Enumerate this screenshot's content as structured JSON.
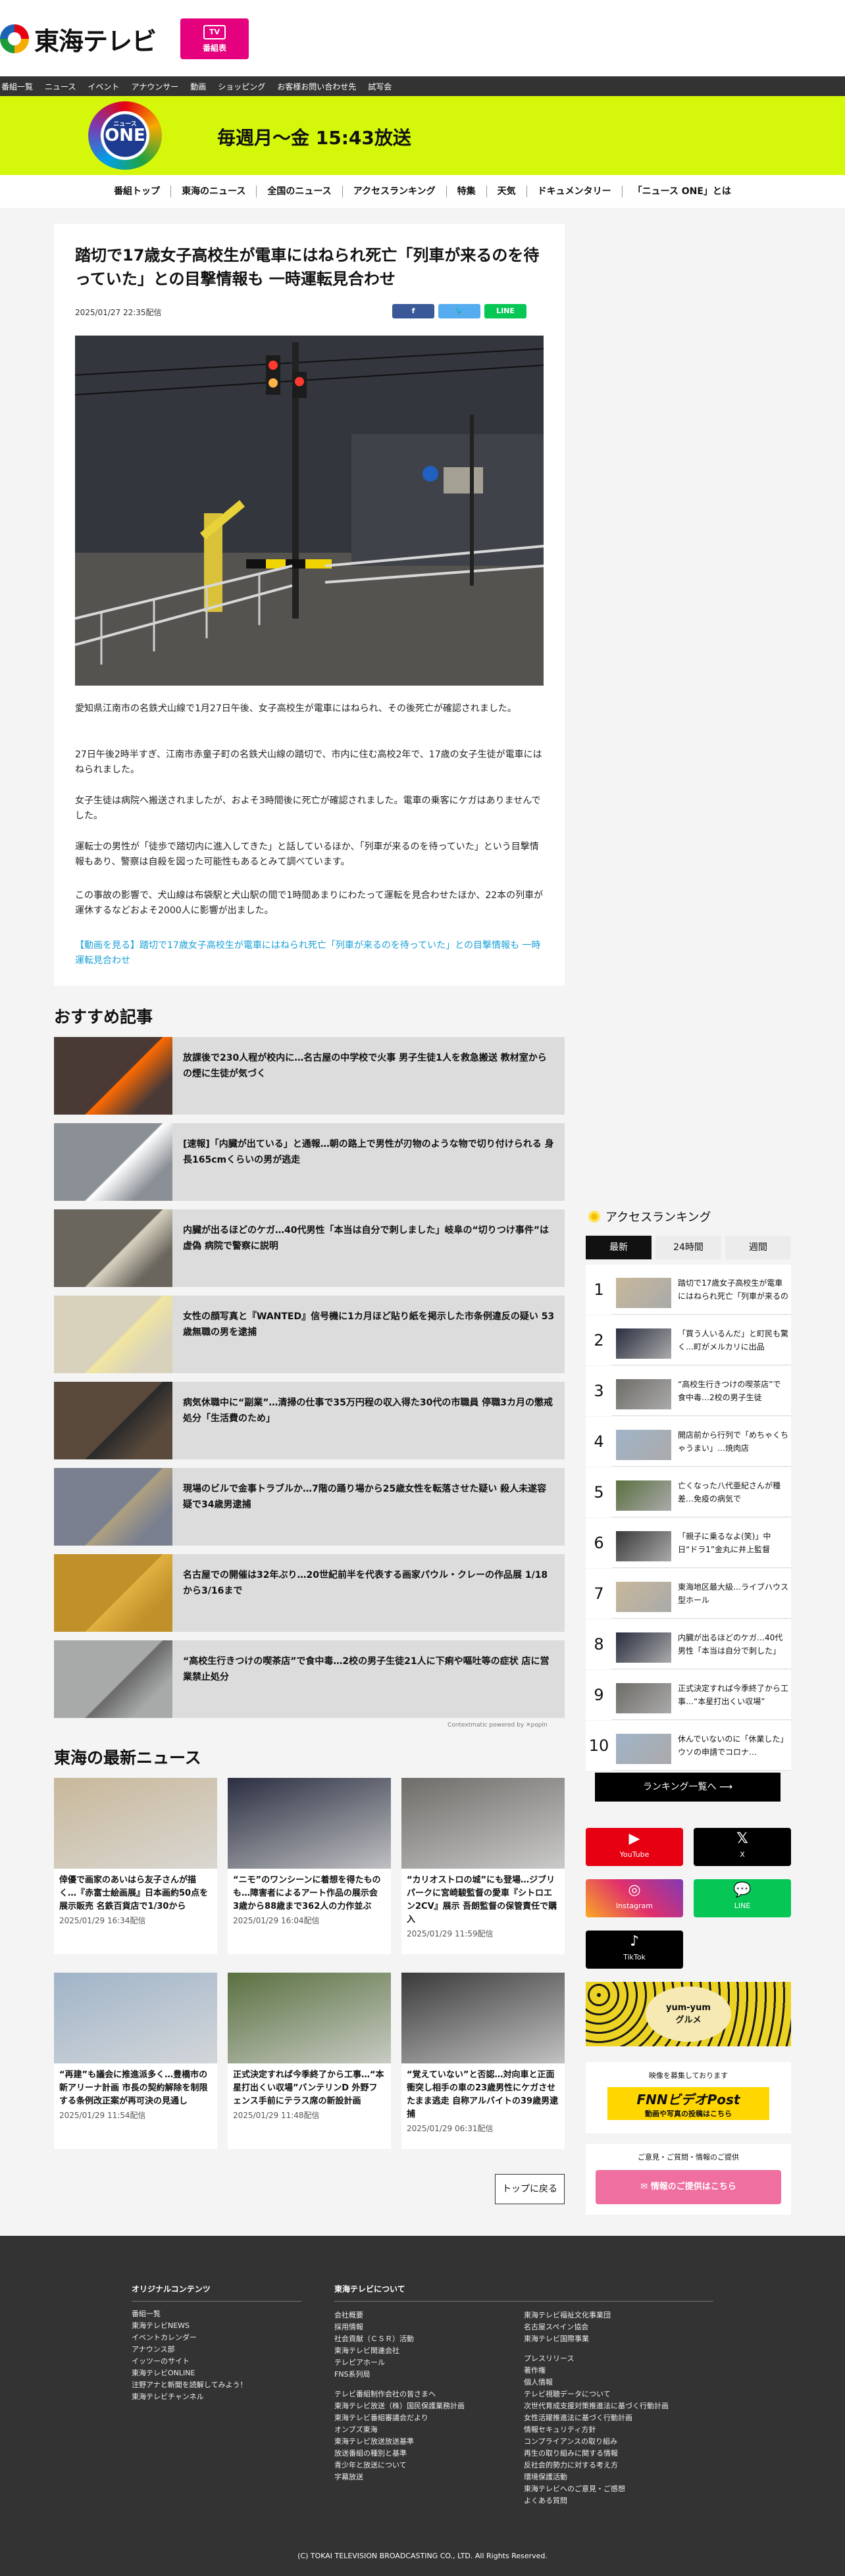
{
  "header": {
    "logo_text": "東海テレビ",
    "tv_button_label": "番組表",
    "tv_icon_text": "TV"
  },
  "nav": [
    "番組一覧",
    "ニュース",
    "イベント",
    "アナウンサー",
    "動画",
    "ショッピング",
    "お客様お問い合わせ先",
    "試写会"
  ],
  "banner": {
    "logo_small": "ニュース",
    "logo_text": "ONE",
    "schedule": "毎週月〜金 15:43放送"
  },
  "subnav": [
    "番組トップ",
    "東海のニュース",
    "全国のニュース",
    "アクセスランキング",
    "特集",
    "天気",
    "ドキュメンタリー",
    "「ニュース ONE」とは"
  ],
  "article": {
    "title": "踏切で17歳女子高校生が電車にはねられ死亡「列車が来るのを待っていた」との目撃情報も 一時運転見合わせ",
    "date": "2025/01/27 22:35配信",
    "share": [
      "f",
      "🐦",
      "LINE"
    ],
    "paragraphs": [
      "愛知県江南市の名鉄犬山線で1月27日午後、女子高校生が電車にはねられ、その後死亡が確認されました。",
      "27日午後2時半すぎ、江南市赤童子町の名鉄犬山線の踏切で、市内に住む高校2年で、17歳の女子生徒が電車にはねられました。",
      "女子生徒は病院へ搬送されましたが、およそ3時間後に死亡が確認されました。電車の乗客にケガはありませんでした。",
      "運転士の男性が「徒歩で踏切内に進入してきた」と話しているほか、「列車が来るのを待っていた」という目撃情報もあり、警察は自殺を図った可能性もあるとみて調べています。",
      "この事故の影響で、犬山線は布袋駅と犬山駅の間で1時間あまりにわたって運転を見合わせたほか、22本の列車が運休するなどおよそ2000人に影響が出ました。"
    ],
    "video_link": "【動画を見る】踏切で17歳女子高校生が電車にはねられ死亡「列車が来るのを待っていた」との目撃情報も 一時運転見合わせ"
  },
  "recommended": {
    "heading": "おすすめ記事",
    "items": [
      "放課後で230人程が校内に…名古屋の中学校で火事 男子生徒1人を救急搬送 教材室からの煙に生徒が気づく",
      "[速報]「内臓が出ている」と通報…朝の路上で男性が刃物のような物で切り付けられる 身長165cmくらいの男が逃走",
      "内臓が出るほどのケガ…40代男性「本当は自分で刺しました」岐阜の“切りつけ事件”は虚偽 病院で警察に説明",
      "女性の顔写真と『WANTED』信号機に1カ月ほど貼り紙を掲示した市条例違反の疑い 53歳無職の男を逮捕",
      "病気休職中に“副業”…清掃の仕事で35万円程の収入得た30代の市職員 停職3カ月の懲戒処分「生活費のため」",
      "現場のビルで金事トラブルか…7階の踊り場から25歳女性を転落させた疑い 殺人未遂容疑で34歳男逮捕",
      "名古屋での開催は32年ぶり…20世紀前半を代表する画家パウル・クレーの作品展 1/18から3/16まで",
      "“高校生行きつけの喫茶店”で食中毒…2校の男子生徒21人に下痢や嘔吐等の症状 店に営業禁止処分"
    ],
    "powered": "Contextmatic powered by ✕popIn"
  },
  "latest": {
    "heading": "東海の最新ニュース",
    "items": [
      {
        "title": "倖優で画家のあいはら友子さんが描く…『赤富士絵画展』日本画約50点を展示販売 名鉄百貨店で1/30から",
        "date": "2025/01/29 16:34配信"
      },
      {
        "title": "“ニモ”のワンシーンに着想を得たものも…障害者によるアート作品の展示会 3歳から88歳まで362人の力作並ぶ",
        "date": "2025/01/29 16:04配信"
      },
      {
        "title": "“カリオストロの城”にも登場…ジブリパークに宮崎駿監督の愛車『シトロエン2CV』展示 吾朗監督の保管責任で購入",
        "date": "2025/01/29 11:59配信"
      },
      {
        "title": "“再建”も議会に推進派多く…豊橋市の新アリーナ計画 市長の契約解除を制限する条例改正案が再可決の見通し",
        "date": "2025/01/29 11:54配信"
      },
      {
        "title": "正式決定すれば今季終了から工事…“本星打出くい収場”バンテリンD 外野フェンス手前にテラス席の新設計画",
        "date": "2025/01/29 11:48配信"
      },
      {
        "title": "“覚えていない”と否認…対向車と正面衝突し相手の車の23歳男性にケガさせたまま逃走 自称アルバイトの39歳男逮捕",
        "date": "2025/01/29 06:31配信"
      }
    ],
    "to_top": "トップに戻る"
  },
  "ranking": {
    "heading": "アクセスランキング",
    "tabs": [
      "最新",
      "24時間",
      "週間"
    ],
    "items": [
      "踏切で17歳女子高校生が電車にはねられ死亡「列車が来るのを待っていた」",
      "「買う人いるんだ」と町民も驚く…町がメルカリに出品",
      "“高校生行きつけの喫茶店”で食中毒…2校の男子生徒",
      "開店前から行列で「めちゃくちゃうまい」…焼肉店",
      "亡くなった八代亜紀さんが種差…免疫の病気で",
      "「親子に乗るなよ(笑)」中日“ドラ1”金丸に井上監督",
      "東海地区最大級…ライブハウス型ホール",
      "内臓が出るほどのケガ…40代男性「本当は自分で刺した」",
      "正式決定すれば今季終了から工事…“本星打出くい収場”",
      "休んでいないのに「休業した」ウソの申請でコロナ…"
    ],
    "all_label": "ランキング一覧へ"
  },
  "sns": [
    {
      "label": "YouTube",
      "icon": "▶",
      "color": "#e60012"
    },
    {
      "label": "X",
      "icon": "𝕏",
      "color": "#000000"
    },
    {
      "label": "Instagram",
      "icon": "◎",
      "color": "#c13584"
    },
    {
      "label": "LINE",
      "icon": "💬",
      "color": "#06c755"
    },
    {
      "label": "TikTok",
      "icon": "♪",
      "color": "#000000"
    }
  ],
  "sidebar_ads": {
    "yum_top": "yum-yum",
    "yum_bottom": "グルメ",
    "fnn_caption": "映像を募集しております",
    "fnn_title": "FNNビデオPost",
    "fnn_sub": "動画や写真の投稿はこちら",
    "info_caption": "ご意見・ご質問・情報のご提供",
    "info_button": "情報のご提供はこちら"
  },
  "footer": {
    "col1_head": "オリジナルコンテンツ",
    "col1": [
      "番組一覧",
      "東海テレビNEWS",
      "イベントカレンダー",
      "アナウンス部",
      "イッツーのサイト",
      "東海テレビONLINE",
      "注野アナと新聞を読解してみよう！",
      "東海テレビチャンネル"
    ],
    "col2_head": "東海テレビについて",
    "col2": [
      "会社概要",
      "採用情報",
      "社会貢献（ＣＳＲ）活動",
      "東海テレビ関連会社",
      "テレピアホール",
      "FNS系列局",
      "",
      "テレビ番組制作会社の皆さまへ",
      "東海テレビ放送（株）国民保護業務計画",
      "東海テレビ番組審議会だより",
      "オンブズ東海",
      "東海テレビ放送放送基準",
      "放送番組の種別と基準",
      "青少年と放送について",
      "字幕放送"
    ],
    "col3": [
      "東海テレビ福祉文化事業団",
      "名古屋スペイン協会",
      "東海テレビ国際事業",
      "",
      "プレスリリース",
      "著作権",
      "個人情報",
      "テレビ視聴データについて",
      "次世代育成支援対策推進法に基づく行動計画",
      "女性活躍推進法に基づく行動計画",
      "情報セキュリティ方針",
      "コンプライアンスの取り組み",
      "再生の取り組みに関する情報",
      "反社会的勢力に対する考え方",
      "環境保護活動",
      "東海テレビへのご意見・ご感想",
      "よくある質問"
    ],
    "copyright": "(C) TOKAI TELEVISION BROADCASTING CO., LTD. All Rights Reserved."
  }
}
